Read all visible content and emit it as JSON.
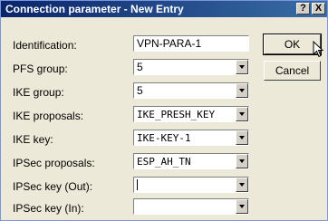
{
  "window": {
    "title": "Connection parameter - New Entry",
    "help_label": "?",
    "close_label": "X"
  },
  "fields": {
    "identification": {
      "label": "Identification:",
      "value": "VPN-PARA-1"
    },
    "pfs_group": {
      "label": "PFS group:",
      "value": "5"
    },
    "ike_group": {
      "label": "IKE group:",
      "value": "5"
    },
    "ike_proposals": {
      "label": "IKE proposals:",
      "value": "IKE_PRESH_KEY"
    },
    "ike_key": {
      "label": "IKE key:",
      "value": "IKE-KEY-1"
    },
    "ipsec_proposals": {
      "label": "IPSec proposals:",
      "value": "ESP_AH_TN"
    },
    "ipsec_key_out": {
      "label": "IPSec key (Out):",
      "value": ""
    },
    "ipsec_key_in": {
      "label": "IPSec key (In):",
      "value": ""
    }
  },
  "buttons": {
    "ok": "OK",
    "cancel": "Cancel"
  },
  "icons": {
    "help": "help-icon",
    "close": "close-icon",
    "dropdown": "chevron-down-icon",
    "cursor": "mouse-pointer-icon"
  }
}
